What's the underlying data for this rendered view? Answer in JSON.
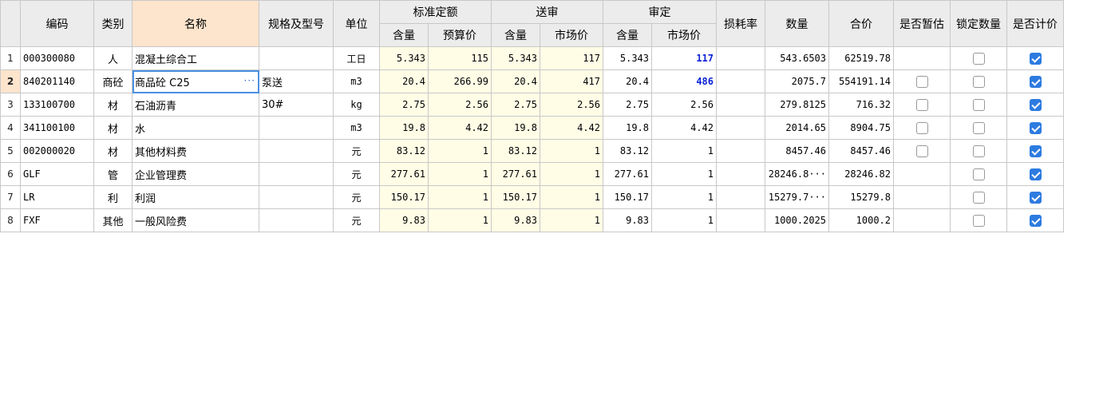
{
  "headers": {
    "code": "编码",
    "type": "类别",
    "name": "名称",
    "spec": "规格及型号",
    "unit": "单位",
    "std": "标准定额",
    "submit": "送审",
    "approve": "审定",
    "loss": "损耗率",
    "qty": "数量",
    "total": "合价",
    "est": "是否暂估",
    "lock": "锁定数量",
    "bill": "是否计价",
    "content": "含量",
    "budget": "预算价",
    "market": "市场价"
  },
  "rows": [
    {
      "idx": "1",
      "code": "000300080",
      "type": "人",
      "name": "混凝土综合工",
      "spec": "",
      "unit": "工日",
      "std_c": "5.343",
      "std_p": "115",
      "sub_c": "5.343",
      "sub_p": "117",
      "app_c": "5.343",
      "app_p": "117",
      "app_p_hi": true,
      "loss": "",
      "qty": "543.6503",
      "total": "62519.78",
      "est": null,
      "lock": false,
      "bill": true
    },
    {
      "idx": "2",
      "code": "840201140",
      "type": "商砼",
      "name": "商品砼 C25",
      "spec": "泵送",
      "unit": "m3",
      "std_c": "20.4",
      "std_p": "266.99",
      "sub_c": "20.4",
      "sub_p": "417",
      "app_c": "20.4",
      "app_p": "486",
      "app_p_hi": true,
      "loss": "",
      "qty": "2075.7",
      "total": "554191.14",
      "est": false,
      "lock": false,
      "bill": true
    },
    {
      "idx": "3",
      "code": "133100700",
      "type": "材",
      "name": "石油沥青",
      "spec": "30#",
      "unit": "kg",
      "std_c": "2.75",
      "std_p": "2.56",
      "sub_c": "2.75",
      "sub_p": "2.56",
      "app_c": "2.75",
      "app_p": "2.56",
      "app_p_hi": false,
      "loss": "",
      "qty": "279.8125",
      "total": "716.32",
      "est": false,
      "lock": false,
      "bill": true
    },
    {
      "idx": "4",
      "code": "341100100",
      "type": "材",
      "name": "水",
      "spec": "",
      "unit": "m3",
      "std_c": "19.8",
      "std_p": "4.42",
      "sub_c": "19.8",
      "sub_p": "4.42",
      "app_c": "19.8",
      "app_p": "4.42",
      "app_p_hi": false,
      "loss": "",
      "qty": "2014.65",
      "total": "8904.75",
      "est": false,
      "lock": false,
      "bill": true
    },
    {
      "idx": "5",
      "code": "002000020",
      "type": "材",
      "name": "其他材料费",
      "spec": "",
      "unit": "元",
      "std_c": "83.12",
      "std_p": "1",
      "sub_c": "83.12",
      "sub_p": "1",
      "app_c": "83.12",
      "app_p": "1",
      "app_p_hi": false,
      "loss": "",
      "qty": "8457.46",
      "total": "8457.46",
      "est": false,
      "lock": false,
      "bill": true
    },
    {
      "idx": "6",
      "code": "GLF",
      "type": "管",
      "name": "企业管理费",
      "spec": "",
      "unit": "元",
      "std_c": "277.61",
      "std_p": "1",
      "sub_c": "277.61",
      "sub_p": "1",
      "app_c": "277.61",
      "app_p": "1",
      "app_p_hi": false,
      "loss": "",
      "qty": "28246.8···",
      "total": "28246.82",
      "est": null,
      "lock": false,
      "bill": true
    },
    {
      "idx": "7",
      "code": "LR",
      "type": "利",
      "name": "利润",
      "spec": "",
      "unit": "元",
      "std_c": "150.17",
      "std_p": "1",
      "sub_c": "150.17",
      "sub_p": "1",
      "app_c": "150.17",
      "app_p": "1",
      "app_p_hi": false,
      "loss": "",
      "qty": "15279.7···",
      "total": "15279.8",
      "est": null,
      "lock": false,
      "bill": true
    },
    {
      "idx": "8",
      "code": "FXF",
      "type": "其他",
      "name": "一般风险费",
      "spec": "",
      "unit": "元",
      "std_c": "9.83",
      "std_p": "1",
      "sub_c": "9.83",
      "sub_p": "1",
      "app_c": "9.83",
      "app_p": "1",
      "app_p_hi": false,
      "loss": "",
      "qty": "1000.2025",
      "total": "1000.2",
      "est": null,
      "lock": false,
      "bill": true
    }
  ],
  "selected_row": "2",
  "colors": {
    "highlight": "#0a22d6",
    "accent": "#2d7be0",
    "header_sel": "#fde4cc",
    "yellow_cell": "#fffde6"
  }
}
